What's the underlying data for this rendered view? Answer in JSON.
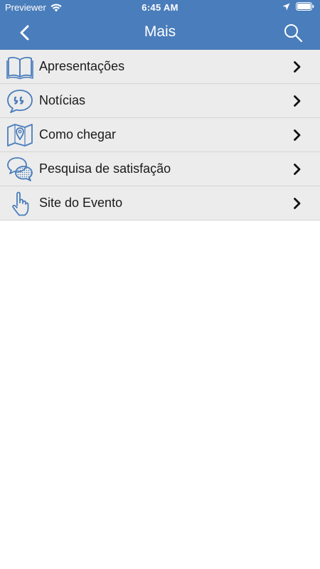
{
  "status_bar": {
    "carrier": "Previewer",
    "time": "6:45 AM"
  },
  "nav": {
    "title": "Mais"
  },
  "menu": {
    "items": [
      {
        "label": "Apresentações",
        "icon": "book-icon"
      },
      {
        "label": "Notícias",
        "icon": "quote-bubble-icon"
      },
      {
        "label": "Como chegar",
        "icon": "map-pin-icon"
      },
      {
        "label": "Pesquisa de satisfação",
        "icon": "chat-bubbles-icon"
      },
      {
        "label": "Site do Evento",
        "icon": "pointer-hand-icon"
      }
    ]
  },
  "colors": {
    "accent": "#4a7dbb",
    "row_background": "#ececec",
    "icon_blue": "#4a7dbb"
  }
}
